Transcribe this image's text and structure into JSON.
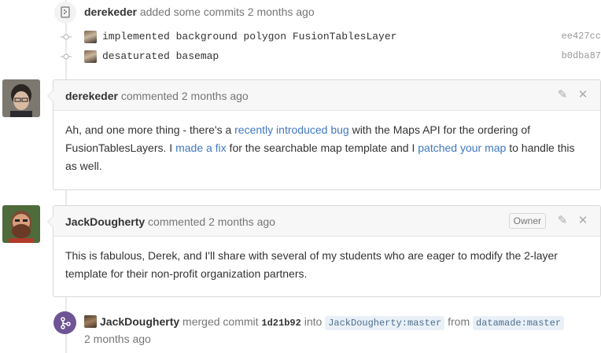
{
  "commits_event": {
    "author": "derekeder",
    "action": "added some commits",
    "time": "2 months ago",
    "commits": [
      {
        "message": "implemented background polygon FusionTablesLayer",
        "sha": "ee427cc"
      },
      {
        "message": "desaturated basemap",
        "sha": "b0dba87"
      }
    ]
  },
  "comments": [
    {
      "author": "derekeder",
      "action": "commented",
      "time": "2 months ago",
      "body": {
        "t1": "Ah, and one more thing - there's a ",
        "link1": "recently introduced bug",
        "t2": " with the Maps API for the ordering of FusionTablesLayers. I ",
        "link2": "made a fix",
        "t3": " for the searchable map template and I ",
        "link3": "patched your map",
        "t4": " to handle this as well."
      }
    },
    {
      "author": "JackDougherty",
      "action": "commented",
      "time": "2 months ago",
      "badge": "Owner",
      "body": "This is fabulous, Derek, and I'll share with several of my students who are eager to modify the 2-layer template for their non-profit organization partners."
    }
  ],
  "merge_event": {
    "author": "JackDougherty",
    "action": "merged commit",
    "sha": "1d21b92",
    "into_word": "into",
    "target_branch": "JackDougherty:master",
    "from_word": "from",
    "source_branch": "datamade:master",
    "time": "2 months ago"
  },
  "colors": {
    "link": "#4078c0",
    "merge": "#6e5494"
  }
}
